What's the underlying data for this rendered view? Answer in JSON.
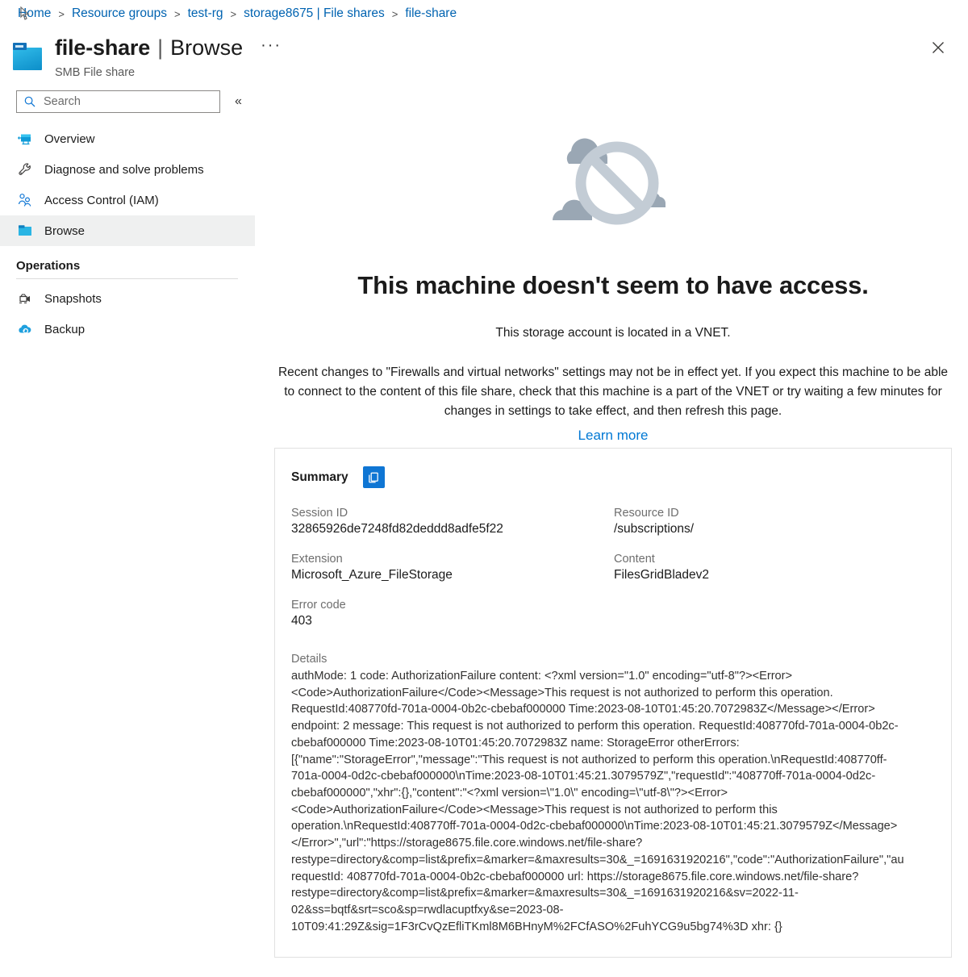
{
  "breadcrumb": {
    "items": [
      "Home",
      "Resource groups",
      "test-rg",
      "storage8675 | File shares",
      "file-share"
    ],
    "separator": ">"
  },
  "header": {
    "resource_name": "file-share",
    "separator": "|",
    "page_name": "Browse",
    "ellipsis": "···",
    "subtitle": "SMB File share",
    "close_label": "✕",
    "folder_icon": "file-share-folder-icon"
  },
  "sidebar": {
    "search": {
      "placeholder": "Search",
      "value": "",
      "icon": "search-icon"
    },
    "collapse_label": "«",
    "items": [
      {
        "label": "Overview",
        "icon": "overview-monitor-icon",
        "selected": false
      },
      {
        "label": "Diagnose and solve problems",
        "icon": "wrench-icon",
        "selected": false
      },
      {
        "label": "Access Control (IAM)",
        "icon": "people-icon",
        "selected": false
      },
      {
        "label": "Browse",
        "icon": "folder-icon",
        "selected": true
      }
    ],
    "group": {
      "title": "Operations",
      "items": [
        {
          "label": "Snapshots",
          "icon": "snapshots-icon"
        },
        {
          "label": "Backup",
          "icon": "cloud-backup-icon"
        }
      ]
    }
  },
  "main": {
    "illustration": "no-access-clouds-icon",
    "heading": "This machine doesn't seem to have access.",
    "subheading": "This storage account is located in a VNET.",
    "body": "Recent changes to \"Firewalls and virtual networks\" settings may not be in effect yet. If you expect this machine to be able to connect to the content of this file share, check that this machine is a part of the VNET or try waiting a few minutes for changes in settings to take effect, and then refresh this page.",
    "learn_more": "Learn more"
  },
  "summary": {
    "title": "Summary",
    "copy_icon": "copy-icon",
    "fields": [
      {
        "label": "Session ID",
        "value": "32865926de7248fd82deddd8adfe5f22"
      },
      {
        "label": "Resource ID",
        "value": "/subscriptions/"
      },
      {
        "label": "Extension",
        "value": "Microsoft_Azure_FileStorage"
      },
      {
        "label": "Content",
        "value": "FilesGridBladev2"
      },
      {
        "label": "Error code",
        "value": "403"
      }
    ],
    "details_label": "Details",
    "details_text": "authMode: 1 code: AuthorizationFailure content: <?xml version=\"1.0\" encoding=\"utf-8\"?><Error>\n<Code>AuthorizationFailure</Code><Message>This request is not authorized to perform this operation.\nRequestId:408770fd-701a-0004-0b2c-cbebaf000000 Time:2023-08-10T01:45:20.7072983Z</Message></Error>\nendpoint: 2 message: This request is not authorized to perform this operation. RequestId:408770fd-701a-0004-0b2c-\ncbebaf000000 Time:2023-08-10T01:45:20.7072983Z name: StorageError otherErrors:\n[{\"name\":\"StorageError\",\"message\":\"This request is not authorized to perform this operation.\\nRequestId:408770ff-\n701a-0004-0d2c-cbebaf000000\\nTime:2023-08-10T01:45:21.3079579Z\",\"requestId\":\"408770ff-701a-0004-0d2c-\ncbebaf000000\",\"xhr\":{},\"content\":\"<?xml version=\\\"1.0\\\" encoding=\\\"utf-8\\\"?><Error>\n<Code>AuthorizationFailure</Code><Message>This request is not authorized to perform this\noperation.\\nRequestId:408770ff-701a-0004-0d2c-cbebaf000000\\nTime:2023-08-10T01:45:21.3079579Z</Message>\n</Error>\",\"url\":\"https://storage8675.file.core.windows.net/file-share?\nrestype=directory&comp=list&prefix=&marker=&maxresults=30&_=1691631920216\",\"code\":\"AuthorizationFailure\",\"au\nrequestId: 408770fd-701a-0004-0b2c-cbebaf000000 url: https://storage8675.file.core.windows.net/file-share?\nrestype=directory&comp=list&prefix=&marker=&maxresults=30&_=1691631920216&sv=2022-11-\n02&ss=bqtf&srt=sco&sp=rwdlacuptfxy&se=2023-08-\n10T09:41:29Z&sig=1F3rCvQzEfliTKml8M6BHnyM%2FCfASO%2FuhYCG9u5bg74%3D xhr: {}"
  },
  "colors": {
    "link": "#0063b1",
    "accent": "#0078d4",
    "copy_button": "#0f76d4",
    "selected_nav": "#eff0f0",
    "illustration_gray": "#9aa7b4"
  }
}
